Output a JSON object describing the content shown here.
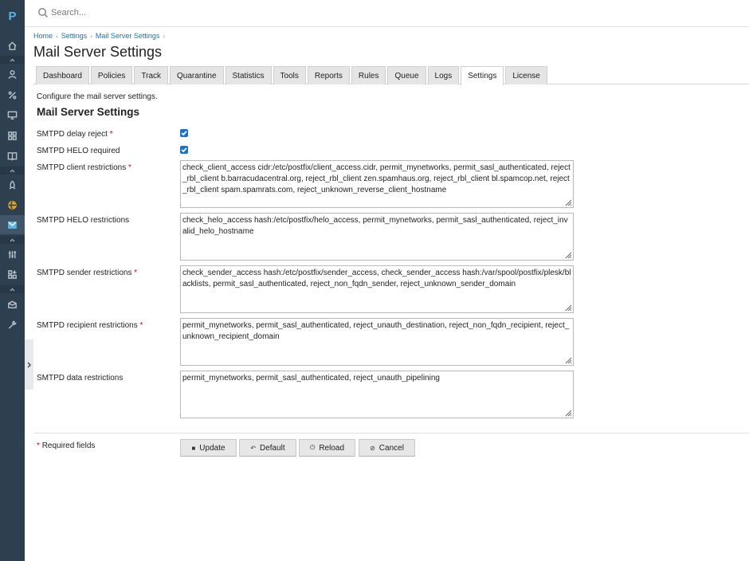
{
  "sidebar": {
    "logo": "P",
    "icons": [
      "home-icon",
      "user-icon",
      "percent-icon",
      "monitor-icon",
      "grid-icon",
      "book-icon",
      "rocket-icon",
      "globe-icon",
      "mail-filter-icon",
      "sliders-icon",
      "apps-icon",
      "box-icon",
      "wrench-icon"
    ]
  },
  "search": {
    "placeholder": "Search..."
  },
  "breadcrumb": [
    "Home",
    "Settings",
    "Mail Server Settings"
  ],
  "page_title": "Mail Server Settings",
  "tabs": [
    "Dashboard",
    "Policies",
    "Track",
    "Quarantine",
    "Statistics",
    "Tools",
    "Reports",
    "Rules",
    "Queue",
    "Logs",
    "Settings",
    "License"
  ],
  "active_tab": "Settings",
  "intro": "Configure the mail server settings.",
  "section_title": "Mail Server Settings",
  "fields": {
    "delay_reject": {
      "label": "SMTPD delay reject",
      "required": "*",
      "checked": true
    },
    "helo_required": {
      "label": "SMTPD HELO required",
      "checked": true
    },
    "client_restrictions": {
      "label": "SMTPD client restrictions",
      "required": "*",
      "value": "check_client_access cidr:/etc/postfix/client_access.cidr, permit_mynetworks, permit_sasl_authenticated, reject_rbl_client b.barracudacentral.org, reject_rbl_client zen.spamhaus.org, reject_rbl_client bl.spamcop.net, reject_rbl_client spam.spamrats.com, reject_unknown_reverse_client_hostname"
    },
    "helo_restrictions": {
      "label": "SMTPD HELO restrictions",
      "value": "check_helo_access hash:/etc/postfix/helo_access, permit_mynetworks, permit_sasl_authenticated, reject_invalid_helo_hostname"
    },
    "sender_restrictions": {
      "label": "SMTPD sender restrictions",
      "required": "*",
      "value": "check_sender_access hash:/etc/postfix/sender_access, check_sender_access hash:/var/spool/postfix/plesk/blacklists, permit_sasl_authenticated, reject_non_fqdn_sender, reject_unknown_sender_domain"
    },
    "recipient_restrictions": {
      "label": "SMTPD recipient restrictions",
      "required": "*",
      "value": "permit_mynetworks, permit_sasl_authenticated, reject_unauth_destination, reject_non_fqdn_recipient, reject_unknown_recipient_domain"
    },
    "data_restrictions": {
      "label": "SMTPD data restrictions",
      "value": "permit_mynetworks, permit_sasl_authenticated, reject_unauth_pipelining"
    }
  },
  "required_note": {
    "star": "*",
    "text": "Required fields"
  },
  "buttons": {
    "update": "Update",
    "default": "Default",
    "reload": "Reload",
    "cancel": "Cancel"
  },
  "colors": {
    "sidebar": "#2e3f50",
    "accent": "#1b72c2",
    "link": "#1a74b0",
    "required": "#d0021b"
  }
}
